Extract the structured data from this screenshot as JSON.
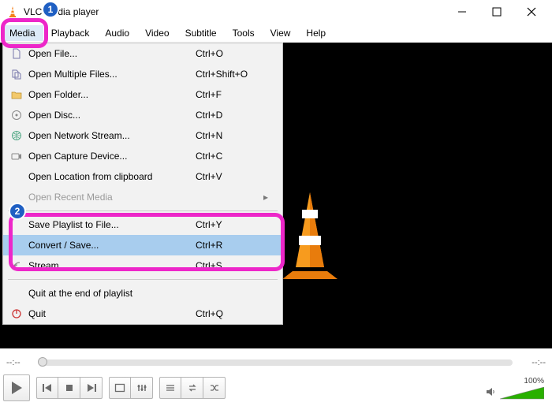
{
  "window": {
    "title": "VLC media player"
  },
  "menubar": [
    "Media",
    "Playback",
    "Audio",
    "Video",
    "Subtitle",
    "Tools",
    "View",
    "Help"
  ],
  "menu": [
    {
      "label": "Open File...",
      "accel": "Ctrl+O",
      "icon": "file"
    },
    {
      "label": "Open Multiple Files...",
      "accel": "Ctrl+Shift+O",
      "icon": "files"
    },
    {
      "label": "Open Folder...",
      "accel": "Ctrl+F",
      "icon": "folder"
    },
    {
      "label": "Open Disc...",
      "accel": "Ctrl+D",
      "icon": "disc"
    },
    {
      "label": "Open Network Stream...",
      "accel": "Ctrl+N",
      "icon": "net"
    },
    {
      "label": "Open Capture Device...",
      "accel": "Ctrl+C",
      "icon": "capture"
    },
    {
      "label": "Open Location from clipboard",
      "accel": "Ctrl+V",
      "icon": ""
    },
    {
      "label": "Open Recent Media",
      "accel": "",
      "icon": "",
      "disabled": true,
      "submenu": true
    },
    {
      "sep": true
    },
    {
      "label": "Save Playlist to File...",
      "accel": "Ctrl+Y",
      "icon": ""
    },
    {
      "label": "Convert / Save...",
      "accel": "Ctrl+R",
      "icon": "",
      "hover": true
    },
    {
      "label": "Stream...",
      "accel": "Ctrl+S",
      "icon": "stream"
    },
    {
      "sep": true
    },
    {
      "label": "Quit at the end of playlist",
      "accel": "",
      "icon": ""
    },
    {
      "label": "Quit",
      "accel": "Ctrl+Q",
      "icon": "quit"
    }
  ],
  "time": {
    "left": "--:--",
    "right": "--:--"
  },
  "volume": {
    "percent": "100%"
  },
  "callouts": {
    "one": "1",
    "two": "2"
  }
}
